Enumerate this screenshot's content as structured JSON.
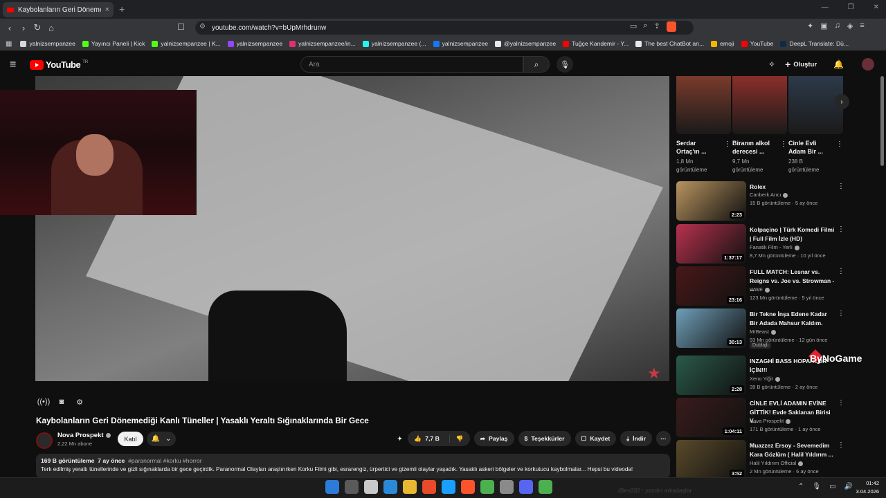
{
  "browser": {
    "tab_title": "Kaybolanların Geri Dönemediği",
    "tab_close": "×",
    "new_tab": "+",
    "url": "youtube.com/watch?v=bUpMrhdrunw",
    "bookmarks": [
      {
        "label": "yalnizsempanzee",
        "color": "#d8d8d8"
      },
      {
        "label": "Yayıncı Paneli | Kick",
        "color": "#53fc18"
      },
      {
        "label": "yalnizsempanzee | K...",
        "color": "#53fc18"
      },
      {
        "label": "yalnizsempanzee",
        "color": "#9146ff"
      },
      {
        "label": "yalnizsempanzee/in...",
        "color": "#e1306c"
      },
      {
        "label": "yalnizsempanzee (...",
        "color": "#25f4ee"
      },
      {
        "label": "yalnizsempanzee",
        "color": "#1877f2"
      },
      {
        "label": "@yalnizsempanzee",
        "color": "#e7e9ea"
      },
      {
        "label": "Tuğçe Kandemir - Y...",
        "color": "#ff0000"
      },
      {
        "label": "The best ChatBot an...",
        "color": "#e7e9ea"
      },
      {
        "label": "emoji",
        "color": "#f4b400"
      },
      {
        "label": "YouTube",
        "color": "#ff0000"
      },
      {
        "label": "DeepL Translate: Dü...",
        "color": "#0f2b46"
      }
    ]
  },
  "header": {
    "logo_text": "YouTube",
    "logo_region": "TR",
    "search_placeholder": "Ara",
    "create_label": "Oluştur"
  },
  "video": {
    "title": "Kaybolanların Geri Dönemediği Kanlı Tüneller | Yasaklı Yeraltı Sığınaklarında Bir Gece",
    "channel": "Nova Prospekt",
    "subscribers": "2,22 Mn abone",
    "join_label": "Katıl",
    "likes": "7,7 B",
    "share_label": "Paylaş",
    "thanks_label": "Teşekkürler",
    "save_label": "Kaydet",
    "download_label": "İndir",
    "views": "169 B görüntüleme",
    "age": "7 ay önce",
    "tags": "#paranormal #korku #horror",
    "description": "Terk edilmiş yeraltı tünellerinde ve gizli sığınaklarda bir gece geçirdik. Paranormal Olayları araştırırken Korku Filmi gibi, esrarengiz, ürpertici ve gizemli olaylar yaşadık. Yasaklı askeri bölgeler ve korkutucu kaybolmalar... Hepsi bu videoda!"
  },
  "shorts": [
    {
      "title": "Serdar Ortaç'ın ...",
      "views": "1,8 Mn görüntüleme",
      "color": "#7a3b2c"
    },
    {
      "title": "Biranın alkol derecesi ...",
      "views": "9,7 Mn görüntüleme",
      "color": "#8a2f2a"
    },
    {
      "title": "Cinle Evli Adam Bir ...",
      "views": "238 B görüntüleme",
      "color": "#2d3a4a"
    }
  ],
  "recommendations": [
    {
      "title": "Rolex",
      "channel": "Canberk Arıcı",
      "meta": "15 B görüntüleme · 5 ay önce",
      "duration": "2:23",
      "color": "#b89460"
    },
    {
      "title": "Kolpaçino | Türk Komedi Filmi | Full Film İzle (HD)",
      "channel": "Fanatik Film - Yerli",
      "meta": "8,7 Mn görüntüleme · 10 yıl önce",
      "duration": "1:37:17",
      "color": "#b8324e"
    },
    {
      "title": "FULL MATCH: Lesnar vs. Reigns vs. Joe vs. Strowman - ...",
      "channel": "WWE",
      "meta": "123 Mn görüntüleme · 5 yıl önce",
      "duration": "23:16",
      "color": "#4a1818"
    },
    {
      "title": "Bir Tekne İnşa Edene Kadar Bir Adada Mahsur Kaldım.",
      "channel": "MrBeast",
      "meta": "93 Mn görüntüleme · 12 gün önce",
      "duration": "30:13",
      "color": "#6f9fb8",
      "badge": "Dublajlı"
    },
    {
      "title": "INZAGHİ BASS HOPARLÖR İÇİN!!!",
      "channel": "Xeno Yiğit",
      "meta": "39 B görüntüleme · 2 ay önce",
      "duration": "2:28",
      "color": "#2a5a4a"
    },
    {
      "title": "CİNLE EVLİ ADAMIN EVİNE GİTTİK! Evde Saklanan Birisi V...",
      "channel": "Nova Prospekt",
      "meta": "171 B görüntüleme · 1 ay önce",
      "duration": "1:04:11",
      "color": "#3a1c1c"
    },
    {
      "title": "Muazzez Ersoy - Sevemedim Kara Gözlüm ( Halil Yıldırım ...",
      "channel": "Halil Yıldırım Official",
      "meta": "2 Mn görüntüleme · 6 ay önce",
      "duration": "3:52",
      "color": "#5a4a2a"
    }
  ],
  "taskbar": {
    "time": "01:42",
    "date": "3.04.2026",
    "icon_colors": [
      "#2d7bd8",
      "#5a5a5a",
      "#c8c8c8",
      "#2a8ad8",
      "#e8b830",
      "#e84a2a",
      "#1a9fff",
      "#fb542b",
      "#4caf50",
      "#8a8a8a",
      "#5865f2",
      "#4caf50"
    ]
  },
  "overlay": {
    "sponsor": "ByNoGame",
    "watermark": "(Ben332 : yazdın arkadaşlar"
  }
}
